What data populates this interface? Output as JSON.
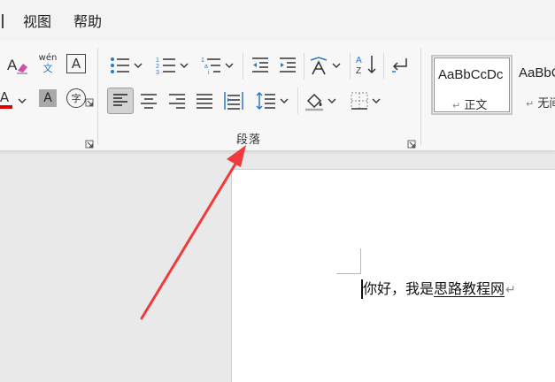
{
  "menu": {
    "view_label": "视图",
    "help_label": "帮助"
  },
  "ribbon": {
    "font_group": {
      "phonetic_label_top": "wén",
      "phonetic_label_bottom": "文",
      "char_border_glyph": "A",
      "font_color_glyph": "A",
      "font_color_value": "#e00000",
      "shading_glyph": "A",
      "enclose_glyph": "字"
    },
    "paragraph_group": {
      "label": "段落",
      "sort_glyph_top": "A",
      "sort_glyph_bottom": "Z"
    },
    "styles": {
      "normal_sample": "AaBbCcDc",
      "normal_name": "正文",
      "nospacing_sample": "AaBbC",
      "nospacing_name": "无间"
    }
  },
  "document": {
    "text_plain": "你好，我是",
    "text_underlined": "思路教程网",
    "paragraph_mark": "↵"
  },
  "colors": {
    "annotation_arrow": "#ef3b3b",
    "accent_blue": "#2a79c9"
  }
}
